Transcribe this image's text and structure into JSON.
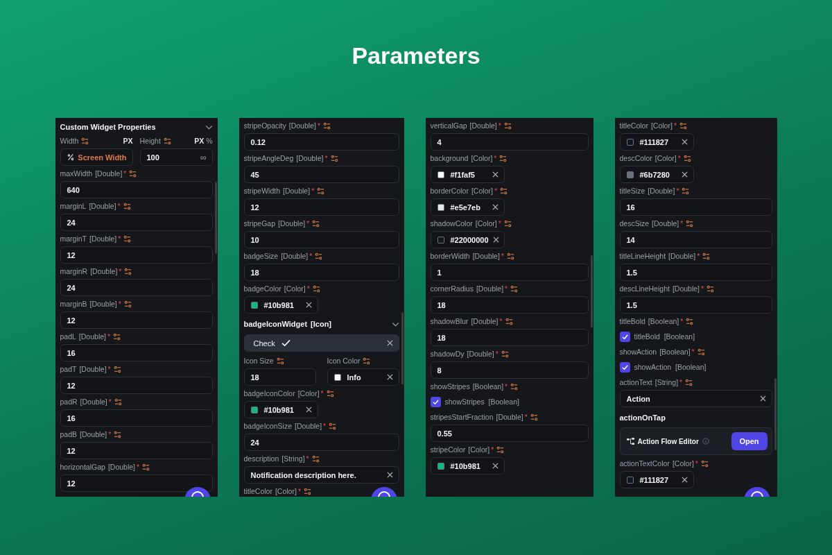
{
  "title": "Parameters",
  "panels": [
    {
      "floating_button": true,
      "items": [
        {
          "kind": "header",
          "title": "Custom Widget Properties",
          "expanded": true
        },
        {
          "kind": "size",
          "width_label": "Width",
          "width_unit": "PX",
          "height_label": "Height",
          "height_unit": "PX",
          "height_alt_unit": "%",
          "width_value": "Screen Width",
          "height_value": "100",
          "height_symbol": "∞"
        },
        {
          "kind": "number",
          "label": "maxWidth",
          "type": "[Double]",
          "required": "*",
          "value": "640"
        },
        {
          "kind": "number",
          "label": "marginL",
          "type": "[Double]",
          "required": "*",
          "value": "24"
        },
        {
          "kind": "number",
          "label": "marginT",
          "type": "[Double]",
          "required": "*",
          "value": "12"
        },
        {
          "kind": "number",
          "label": "marginR",
          "type": "[Double]",
          "required": "*",
          "value": "24"
        },
        {
          "kind": "number",
          "label": "marginB",
          "type": "[Double]",
          "required": "*",
          "value": "12"
        },
        {
          "kind": "number",
          "label": "padL",
          "type": "[Double]",
          "required": "*",
          "value": "16"
        },
        {
          "kind": "number",
          "label": "padT",
          "type": "[Double]",
          "required": "*",
          "value": "12"
        },
        {
          "kind": "number",
          "label": "padR",
          "type": "[Double]",
          "required": "*",
          "value": "16"
        },
        {
          "kind": "number",
          "label": "padB",
          "type": "[Double]",
          "required": "*",
          "value": "12"
        },
        {
          "kind": "number",
          "label": "horizontalGap",
          "type": "[Double]",
          "required": "*",
          "value": "12"
        }
      ]
    },
    {
      "floating_button": true,
      "items": [
        {
          "kind": "number",
          "label": "stripeOpacity",
          "type": "[Double]",
          "required": "*",
          "value": "0.12"
        },
        {
          "kind": "number",
          "label": "stripeAngleDeg",
          "type": "[Double]",
          "required": "*",
          "value": "45"
        },
        {
          "kind": "number",
          "label": "stripeWidth",
          "type": "[Double]",
          "required": "*",
          "value": "12"
        },
        {
          "kind": "number",
          "label": "stripeGap",
          "type": "[Double]",
          "required": "*",
          "value": "10"
        },
        {
          "kind": "number",
          "label": "badgeSize",
          "type": "[Double]",
          "required": "*",
          "value": "18"
        },
        {
          "kind": "color",
          "label": "badgeColor",
          "type": "[Color]",
          "required": "*",
          "value": "#10b981",
          "color": "#10b981"
        },
        {
          "kind": "section",
          "title": "badgeIconWidget",
          "type": "[Icon]",
          "expanded": true
        },
        {
          "kind": "icon",
          "value": "Check"
        },
        {
          "kind": "iconrow",
          "size_label": "Icon Size",
          "size_value": "18",
          "color_label": "Icon Color",
          "color_value": "Info",
          "color": "#ffffff"
        },
        {
          "kind": "color",
          "label": "badgeIconColor",
          "type": "[Color]",
          "required": "*",
          "value": "#10b981",
          "color": "#10b981"
        },
        {
          "kind": "number",
          "label": "badgeIconSize",
          "type": "[Double]",
          "required": "*",
          "value": "24"
        },
        {
          "kind": "string",
          "label": "description",
          "type": "[String]",
          "required": "*",
          "value": "Notification description here."
        },
        {
          "kind": "label",
          "label": "titleColor",
          "type": "[Color]",
          "required": "*"
        }
      ]
    },
    {
      "floating_button": false,
      "items": [
        {
          "kind": "number",
          "label": "verticalGap",
          "type": "[Double]",
          "required": "*",
          "value": "4"
        },
        {
          "kind": "color",
          "label": "background",
          "type": "[Color]",
          "required": "*",
          "value": "#f1faf5",
          "color": "#f1faf5"
        },
        {
          "kind": "color",
          "label": "borderColor",
          "type": "[Color]",
          "required": "*",
          "value": "#e5e7eb",
          "color": "#e5e7eb"
        },
        {
          "kind": "color",
          "label": "shadowColor",
          "type": "[Color]",
          "required": "*",
          "value": "#22000000",
          "color": "#16181b"
        },
        {
          "kind": "number",
          "label": "borderWidth",
          "type": "[Double]",
          "required": "*",
          "value": "1"
        },
        {
          "kind": "number",
          "label": "cornerRadius",
          "type": "[Double]",
          "required": "*",
          "value": "18"
        },
        {
          "kind": "number",
          "label": "shadowBlur",
          "type": "[Double]",
          "required": "*",
          "value": "18"
        },
        {
          "kind": "number",
          "label": "shadowDy",
          "type": "[Double]",
          "required": "*",
          "value": "8"
        },
        {
          "kind": "bool",
          "label": "showStripes",
          "type": "[Boolean]",
          "required": "*",
          "text": "showStripes  [Boolean]",
          "checked": true
        },
        {
          "kind": "number",
          "label": "stripesStartFraction",
          "type": "[Double]",
          "required": "*",
          "value": "0.55"
        },
        {
          "kind": "color",
          "label": "stripeColor",
          "type": "[Color]",
          "required": "*",
          "value": "#10b981",
          "color": "#10b981"
        }
      ]
    },
    {
      "floating_button": true,
      "items": [
        {
          "kind": "color",
          "label": "titleColor",
          "type": "[Color]",
          "required": "*",
          "value": "#111827",
          "color": "#111827"
        },
        {
          "kind": "color",
          "label": "descColor",
          "type": "[Color]",
          "required": "*",
          "value": "#6b7280",
          "color": "#6b7280"
        },
        {
          "kind": "number",
          "label": "titleSize",
          "type": "[Double]",
          "required": "*",
          "value": "16"
        },
        {
          "kind": "number",
          "label": "descSize",
          "type": "[Double]",
          "required": "*",
          "value": "14"
        },
        {
          "kind": "number",
          "label": "titleLineHeight",
          "type": "[Double]",
          "required": "*",
          "value": "1.5"
        },
        {
          "kind": "number",
          "label": "descLineHeight",
          "type": "[Double]",
          "required": "*",
          "value": "1.5"
        },
        {
          "kind": "bool",
          "label": "titleBold",
          "type": "[Boolean]",
          "required": "*",
          "text": "titleBold  [Boolean]",
          "checked": true
        },
        {
          "kind": "bool",
          "label": "showAction",
          "type": "[Boolean]",
          "required": "*",
          "text": "showAction  [Boolean]",
          "checked": true
        },
        {
          "kind": "string",
          "label": "actionText",
          "type": "[String]",
          "required": "*",
          "value": "Action"
        },
        {
          "kind": "heading",
          "title": "actionOnTap"
        },
        {
          "kind": "action",
          "title": "Action Flow Editor",
          "button": "Open"
        },
        {
          "kind": "color",
          "label": "actionTextColor",
          "type": "[Color]",
          "required": "*",
          "value": "#111827",
          "color": "#111827"
        }
      ]
    }
  ]
}
